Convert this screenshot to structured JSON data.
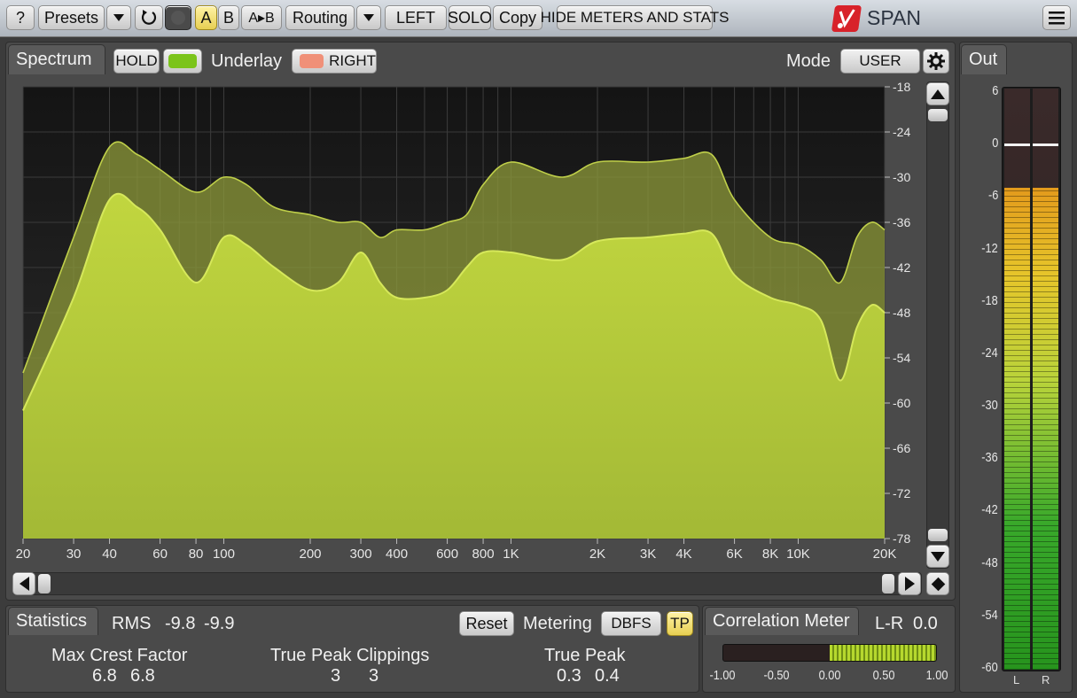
{
  "toolbar": {
    "help_label": "?",
    "presets_label": "Presets",
    "ab_a": "A",
    "ab_b": "B",
    "ab_atob": "A▸B",
    "routing_label": "Routing",
    "channel_label": "LEFT",
    "solo_label": "SOLO",
    "copy_label": "Copy",
    "hide_meters_label": "HIDE METERS AND STATS",
    "brand": "SPAN",
    "icons": {
      "undo": "undo-icon",
      "menu": "hamburger-menu-icon",
      "dropdown": "chevron-down-icon"
    }
  },
  "spectrum": {
    "tab_label": "Spectrum",
    "hold_label": "HOLD",
    "underlay_label": "Underlay",
    "underlay_channel": "RIGHT",
    "mode_label": "Mode",
    "mode_value": "USER",
    "hold_color": "#7bc41a",
    "underlay_color": "#f09078",
    "db_ticks": [
      "-18",
      "-24",
      "-30",
      "-36",
      "-42",
      "-48",
      "-54",
      "-60",
      "-66",
      "-72",
      "-78"
    ],
    "freq_ticks": [
      "20",
      "30",
      "40",
      "60",
      "80",
      "100",
      "200",
      "300",
      "400",
      "600",
      "800",
      "1K",
      "2K",
      "3K",
      "4K",
      "6K",
      "8K",
      "10K",
      "20K"
    ]
  },
  "chart_data": {
    "type": "area",
    "x_scale": "log",
    "xlim": [
      20,
      20000
    ],
    "ylim": [
      -78,
      -18
    ],
    "ylabel": "",
    "xlabel": "",
    "series": [
      {
        "color": "#b7cc3c",
        "points": [
          [
            20,
            -61
          ],
          [
            30,
            -46
          ],
          [
            40,
            -33
          ],
          [
            50,
            -34
          ],
          [
            60,
            -37
          ],
          [
            80,
            -44
          ],
          [
            100,
            -38
          ],
          [
            120,
            -39
          ],
          [
            150,
            -42
          ],
          [
            200,
            -45
          ],
          [
            250,
            -44
          ],
          [
            300,
            -40
          ],
          [
            350,
            -44
          ],
          [
            400,
            -46
          ],
          [
            500,
            -46
          ],
          [
            600,
            -45
          ],
          [
            700,
            -42
          ],
          [
            800,
            -40
          ],
          [
            1000,
            -40
          ],
          [
            1500,
            -41
          ],
          [
            2000,
            -38.5
          ],
          [
            3000,
            -38
          ],
          [
            4000,
            -37.5
          ],
          [
            5000,
            -37.5
          ],
          [
            6000,
            -43
          ],
          [
            8000,
            -46
          ],
          [
            10000,
            -47
          ],
          [
            12000,
            -49
          ],
          [
            14000,
            -57
          ],
          [
            16000,
            -50
          ],
          [
            18000,
            -47
          ],
          [
            20000,
            -48
          ]
        ]
      },
      {
        "color": "#8e9a3a",
        "points": [
          [
            20,
            -56
          ],
          [
            30,
            -38
          ],
          [
            40,
            -26
          ],
          [
            50,
            -27
          ],
          [
            60,
            -29
          ],
          [
            80,
            -32
          ],
          [
            100,
            -30
          ],
          [
            120,
            -31
          ],
          [
            150,
            -34
          ],
          [
            200,
            -35
          ],
          [
            250,
            -36
          ],
          [
            300,
            -36
          ],
          [
            350,
            -38
          ],
          [
            400,
            -37
          ],
          [
            500,
            -37
          ],
          [
            600,
            -36
          ],
          [
            700,
            -35
          ],
          [
            800,
            -31
          ],
          [
            1000,
            -28
          ],
          [
            1500,
            -30
          ],
          [
            2000,
            -28
          ],
          [
            3000,
            -28
          ],
          [
            4000,
            -27.5
          ],
          [
            5000,
            -27
          ],
          [
            6000,
            -33
          ],
          [
            8000,
            -38
          ],
          [
            10000,
            -39
          ],
          [
            12000,
            -41
          ],
          [
            14000,
            -44
          ],
          [
            16000,
            -38
          ],
          [
            18000,
            -36
          ],
          [
            20000,
            -37
          ]
        ]
      }
    ]
  },
  "out_meter": {
    "tab_label": "Out",
    "ticks": [
      "6",
      "0",
      "-6",
      "-12",
      "-18",
      "-24",
      "-30",
      "-36",
      "-42",
      "-48",
      "-54",
      "-60"
    ],
    "channels": [
      "L",
      "R"
    ],
    "level_l_db": -5,
    "level_r_db": -5,
    "peak_hold_db": 0
  },
  "statistics": {
    "tab_label": "Statistics",
    "rms_label": "RMS",
    "rms_l": "-9.8",
    "rms_r": "-9.9",
    "reset_label": "Reset",
    "metering_label": "Metering",
    "metering_value": "DBFS",
    "tp_label": "TP",
    "max_crest_label": "Max Crest Factor",
    "max_crest_l": "6.8",
    "max_crest_r": "6.8",
    "tp_clip_label": "True Peak Clippings",
    "tp_clip_l": "3",
    "tp_clip_r": "3",
    "true_peak_label": "True Peak",
    "true_peak_l": "0.3",
    "true_peak_r": "0.4"
  },
  "correlation": {
    "tab_label": "Correlation Meter",
    "mode_label": "L-R",
    "value": "0.0",
    "ticks": [
      "-1.00",
      "-0.50",
      "0.00",
      "0.50",
      "1.00"
    ],
    "range_low": 0.0,
    "range_high": 1.0
  }
}
